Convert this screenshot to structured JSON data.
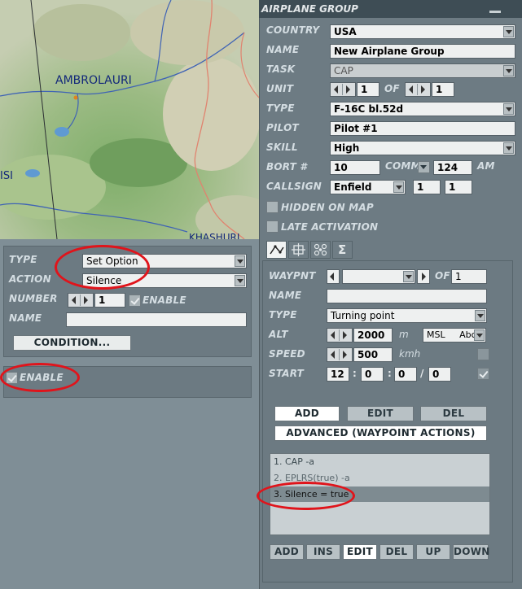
{
  "map": {
    "label_ambrolauri": "AMBROLAURI",
    "label_isi": "ISI",
    "label_khashuri": "KHASHURI"
  },
  "trigger_panel": {
    "type_label": "TYPE",
    "type_value": "Set Option",
    "action_label": "ACTION",
    "action_value": "Silence",
    "number_label": "NUMBER",
    "number_value": "1",
    "enable_label": "ENABLE",
    "name_label": "NAME",
    "name_value": "",
    "condition_button": "CONDITION..."
  },
  "enable_panel": {
    "label": "ENABLE"
  },
  "group": {
    "title": "AIRPLANE GROUP",
    "country_label": "COUNTRY",
    "country": "USA",
    "name_label": "NAME",
    "name": "New Airplane Group",
    "task_label": "TASK",
    "task": "CAP",
    "unit_label": "UNIT",
    "unit": "1",
    "of_label": "OF",
    "unit_of": "1",
    "type_label": "TYPE",
    "type": "F-16C bl.52d",
    "pilot_label": "PILOT",
    "pilot": "Pilot #1",
    "skill_label": "SKILL",
    "skill": "High",
    "bort_label": "BORT #",
    "bort": "10",
    "comm_label": "COMM",
    "comm": "124",
    "am_label": "AM",
    "callsign_label": "CALLSIGN",
    "callsign": "Enfield",
    "callsign_n1": "1",
    "callsign_n2": "1",
    "hidden_label": "HIDDEN ON MAP",
    "late_label": "LATE ACTIVATION",
    "tab_icons": [
      "route-icon",
      "target-icon",
      "payload-icon",
      "summary-sigma-icon"
    ],
    "sigma_glyph": "Σ"
  },
  "waypoint": {
    "waypnt_label": "WAYPNT",
    "of_label": "OF",
    "of_value": "1",
    "name_label": "NAME",
    "name_value": "",
    "type_label": "TYPE",
    "type_value": "Turning point",
    "alt_label": "ALT",
    "alt_value": "2000",
    "alt_unit": "m",
    "alt_ref": "MSL",
    "alt_ref2": "Abc",
    "speed_label": "SPEED",
    "speed_value": "500",
    "speed_unit": "kmh",
    "start_label": "START",
    "start_h": "12",
    "start_m": "0",
    "start_s": "0",
    "start_d": "0",
    "sep_colon": ":",
    "sep_slash": "/",
    "add_button": "ADD",
    "edit_button": "EDIT",
    "del_button": "DEL",
    "advanced_button": "ADVANCED (WAYPOINT ACTIONS)"
  },
  "actions": {
    "items": [
      "1. CAP -a",
      "2. EPLRS(true) -a",
      "3. Silence = true"
    ],
    "buttons": {
      "add": "ADD",
      "ins": "INS",
      "edit": "EDIT",
      "del": "DEL",
      "up": "UP",
      "down": "DOWN"
    }
  },
  "colors": {
    "highlight_ring": "#e0141b",
    "panel": "#6d7b83",
    "title_bar": "#3e4d55"
  }
}
